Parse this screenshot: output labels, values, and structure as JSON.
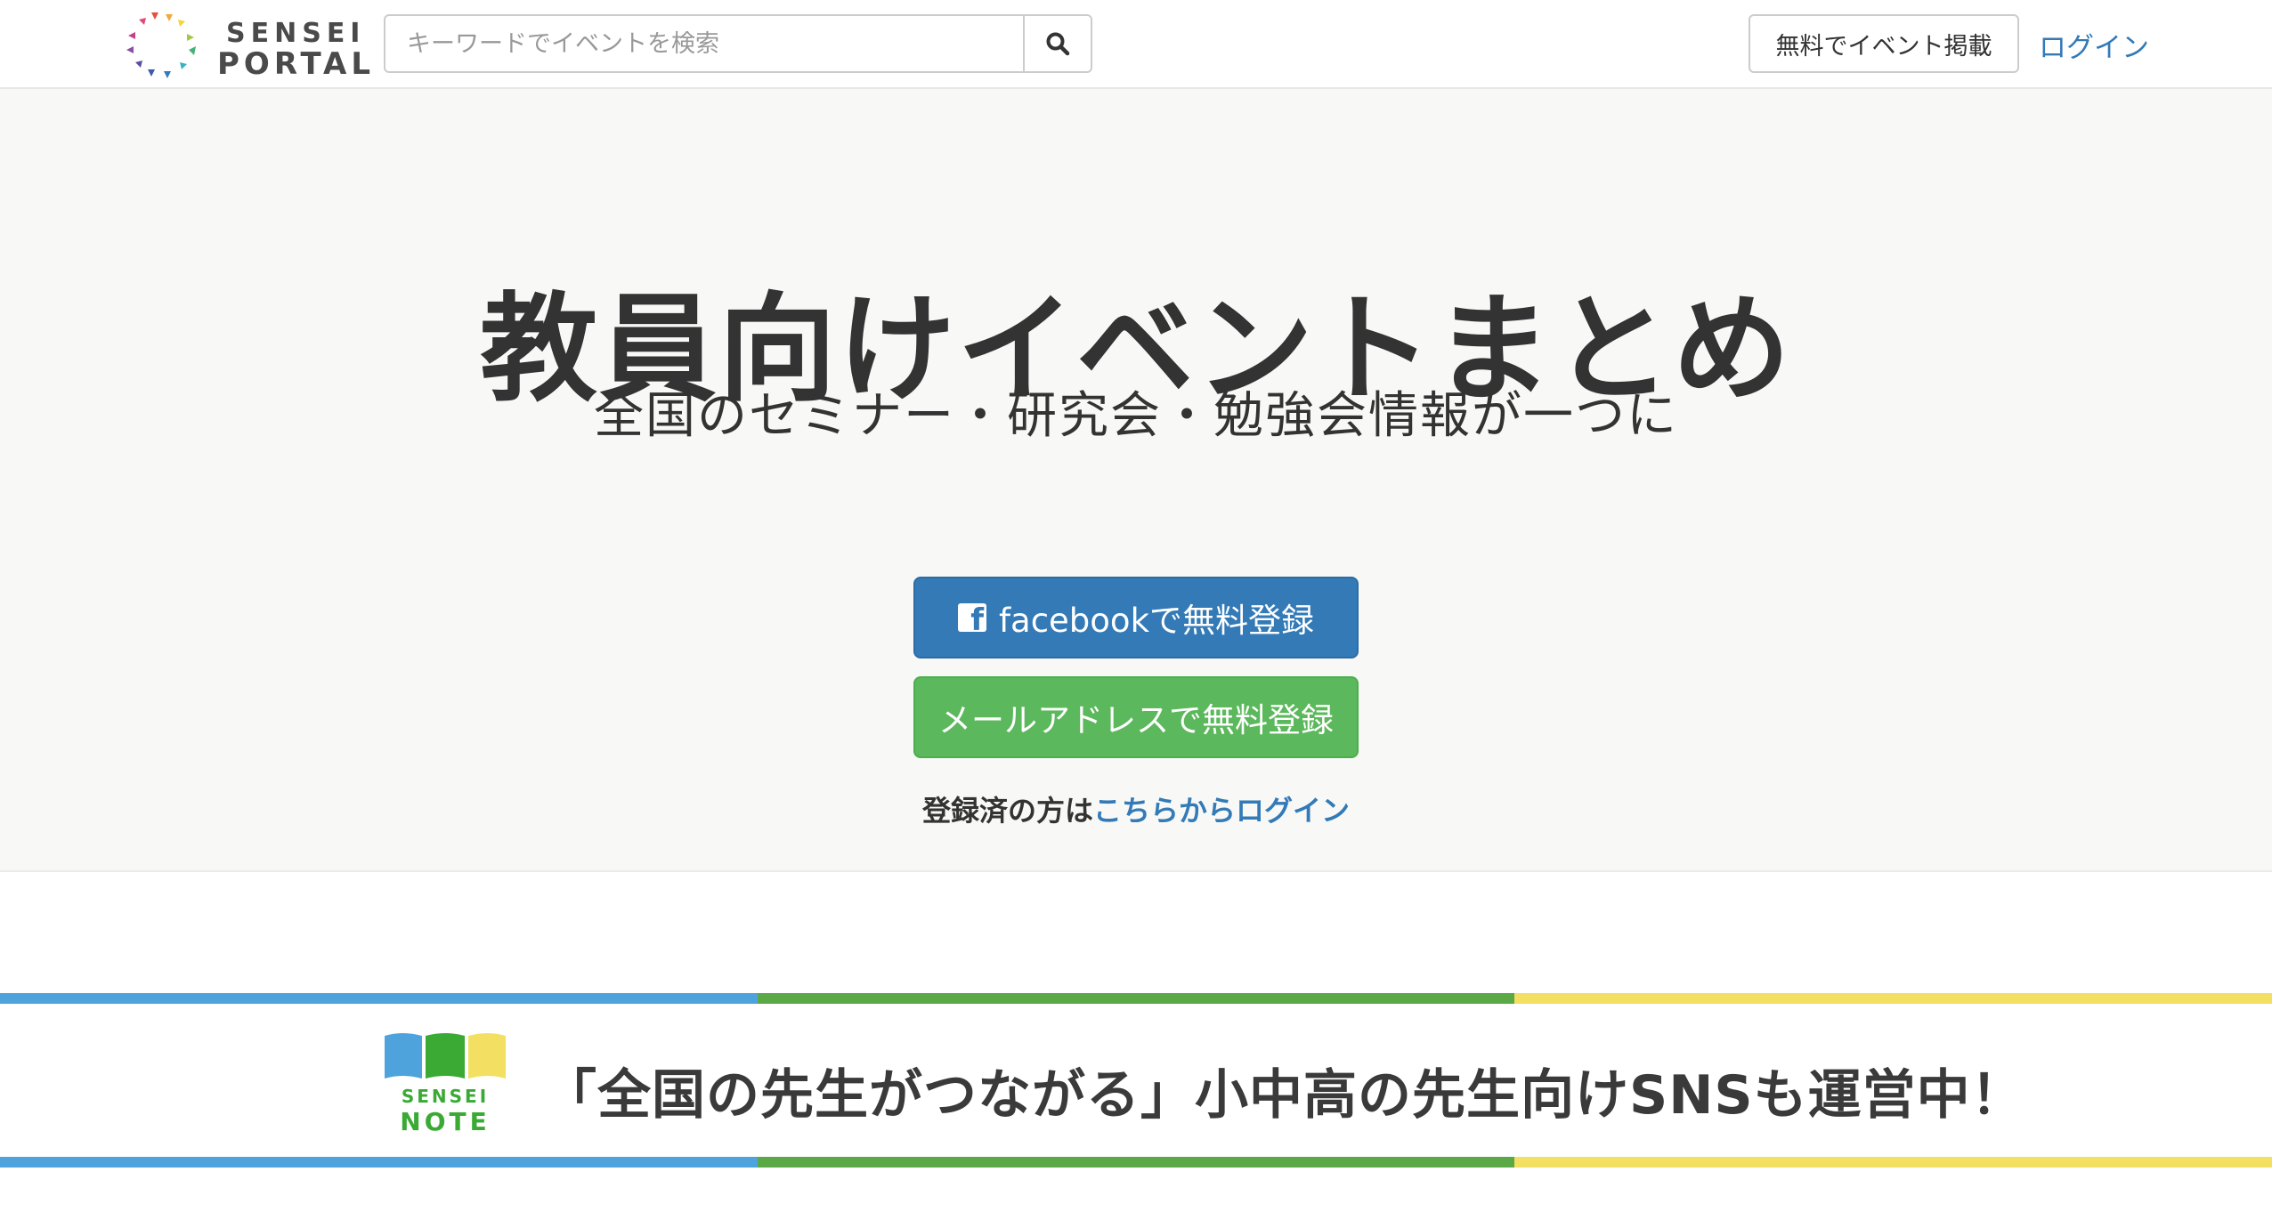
{
  "header": {
    "logo_line1": "SENSEI",
    "logo_line2": "PORTAL",
    "search_placeholder": "キーワードでイベントを検索",
    "search_icon": "search-icon",
    "post_event_label": "無料でイベント掲載",
    "login_label": "ログイン"
  },
  "hero": {
    "title": "教員向けイベントまとめ",
    "subtitle": "全国のセミナー・研究会・勉強会情報が一つに",
    "facebook_icon_letter": "f",
    "facebook_button_label": "facebookで無料登録",
    "email_button_label": "メールアドレスで無料登録",
    "registered_prefix": "登録済の方は",
    "registered_link": "こちらからログイン"
  },
  "banner": {
    "logo_line1": "SENSEI",
    "logo_line2": "NOTE",
    "text": "「全国の先生がつながる」小中高の先生向けSNSも運営中！",
    "stripe_colors": [
      "#4fa3dd",
      "#5ba847",
      "#f3df62"
    ]
  },
  "colors": {
    "link": "#337ab7",
    "facebook": "#337ab7",
    "email": "#5cb85c",
    "hero_bg": "#f8f9f7"
  }
}
